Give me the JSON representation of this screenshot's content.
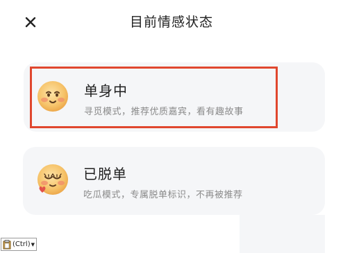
{
  "header": {
    "title": "目前情感状态",
    "close_icon": "close-icon"
  },
  "options": [
    {
      "title": "单身中",
      "description": "寻觅模式，推荐优质嘉宾，看有趣故事",
      "icon": "smiling-blush-emoji-icon",
      "selected": true
    },
    {
      "title": "已脱单",
      "description": "吃瓜模式，专属脱单标识，不再被推荐",
      "icon": "heart-eyes-blush-emoji-icon",
      "selected": false
    }
  ],
  "paste_options": {
    "label": "(Ctrl)",
    "icon": "clipboard-icon"
  },
  "colors": {
    "highlight": "#e0472e",
    "card_bg": "#f5f6f8",
    "emoji_face": "#f6c36a",
    "blush": "#f08a6a"
  }
}
